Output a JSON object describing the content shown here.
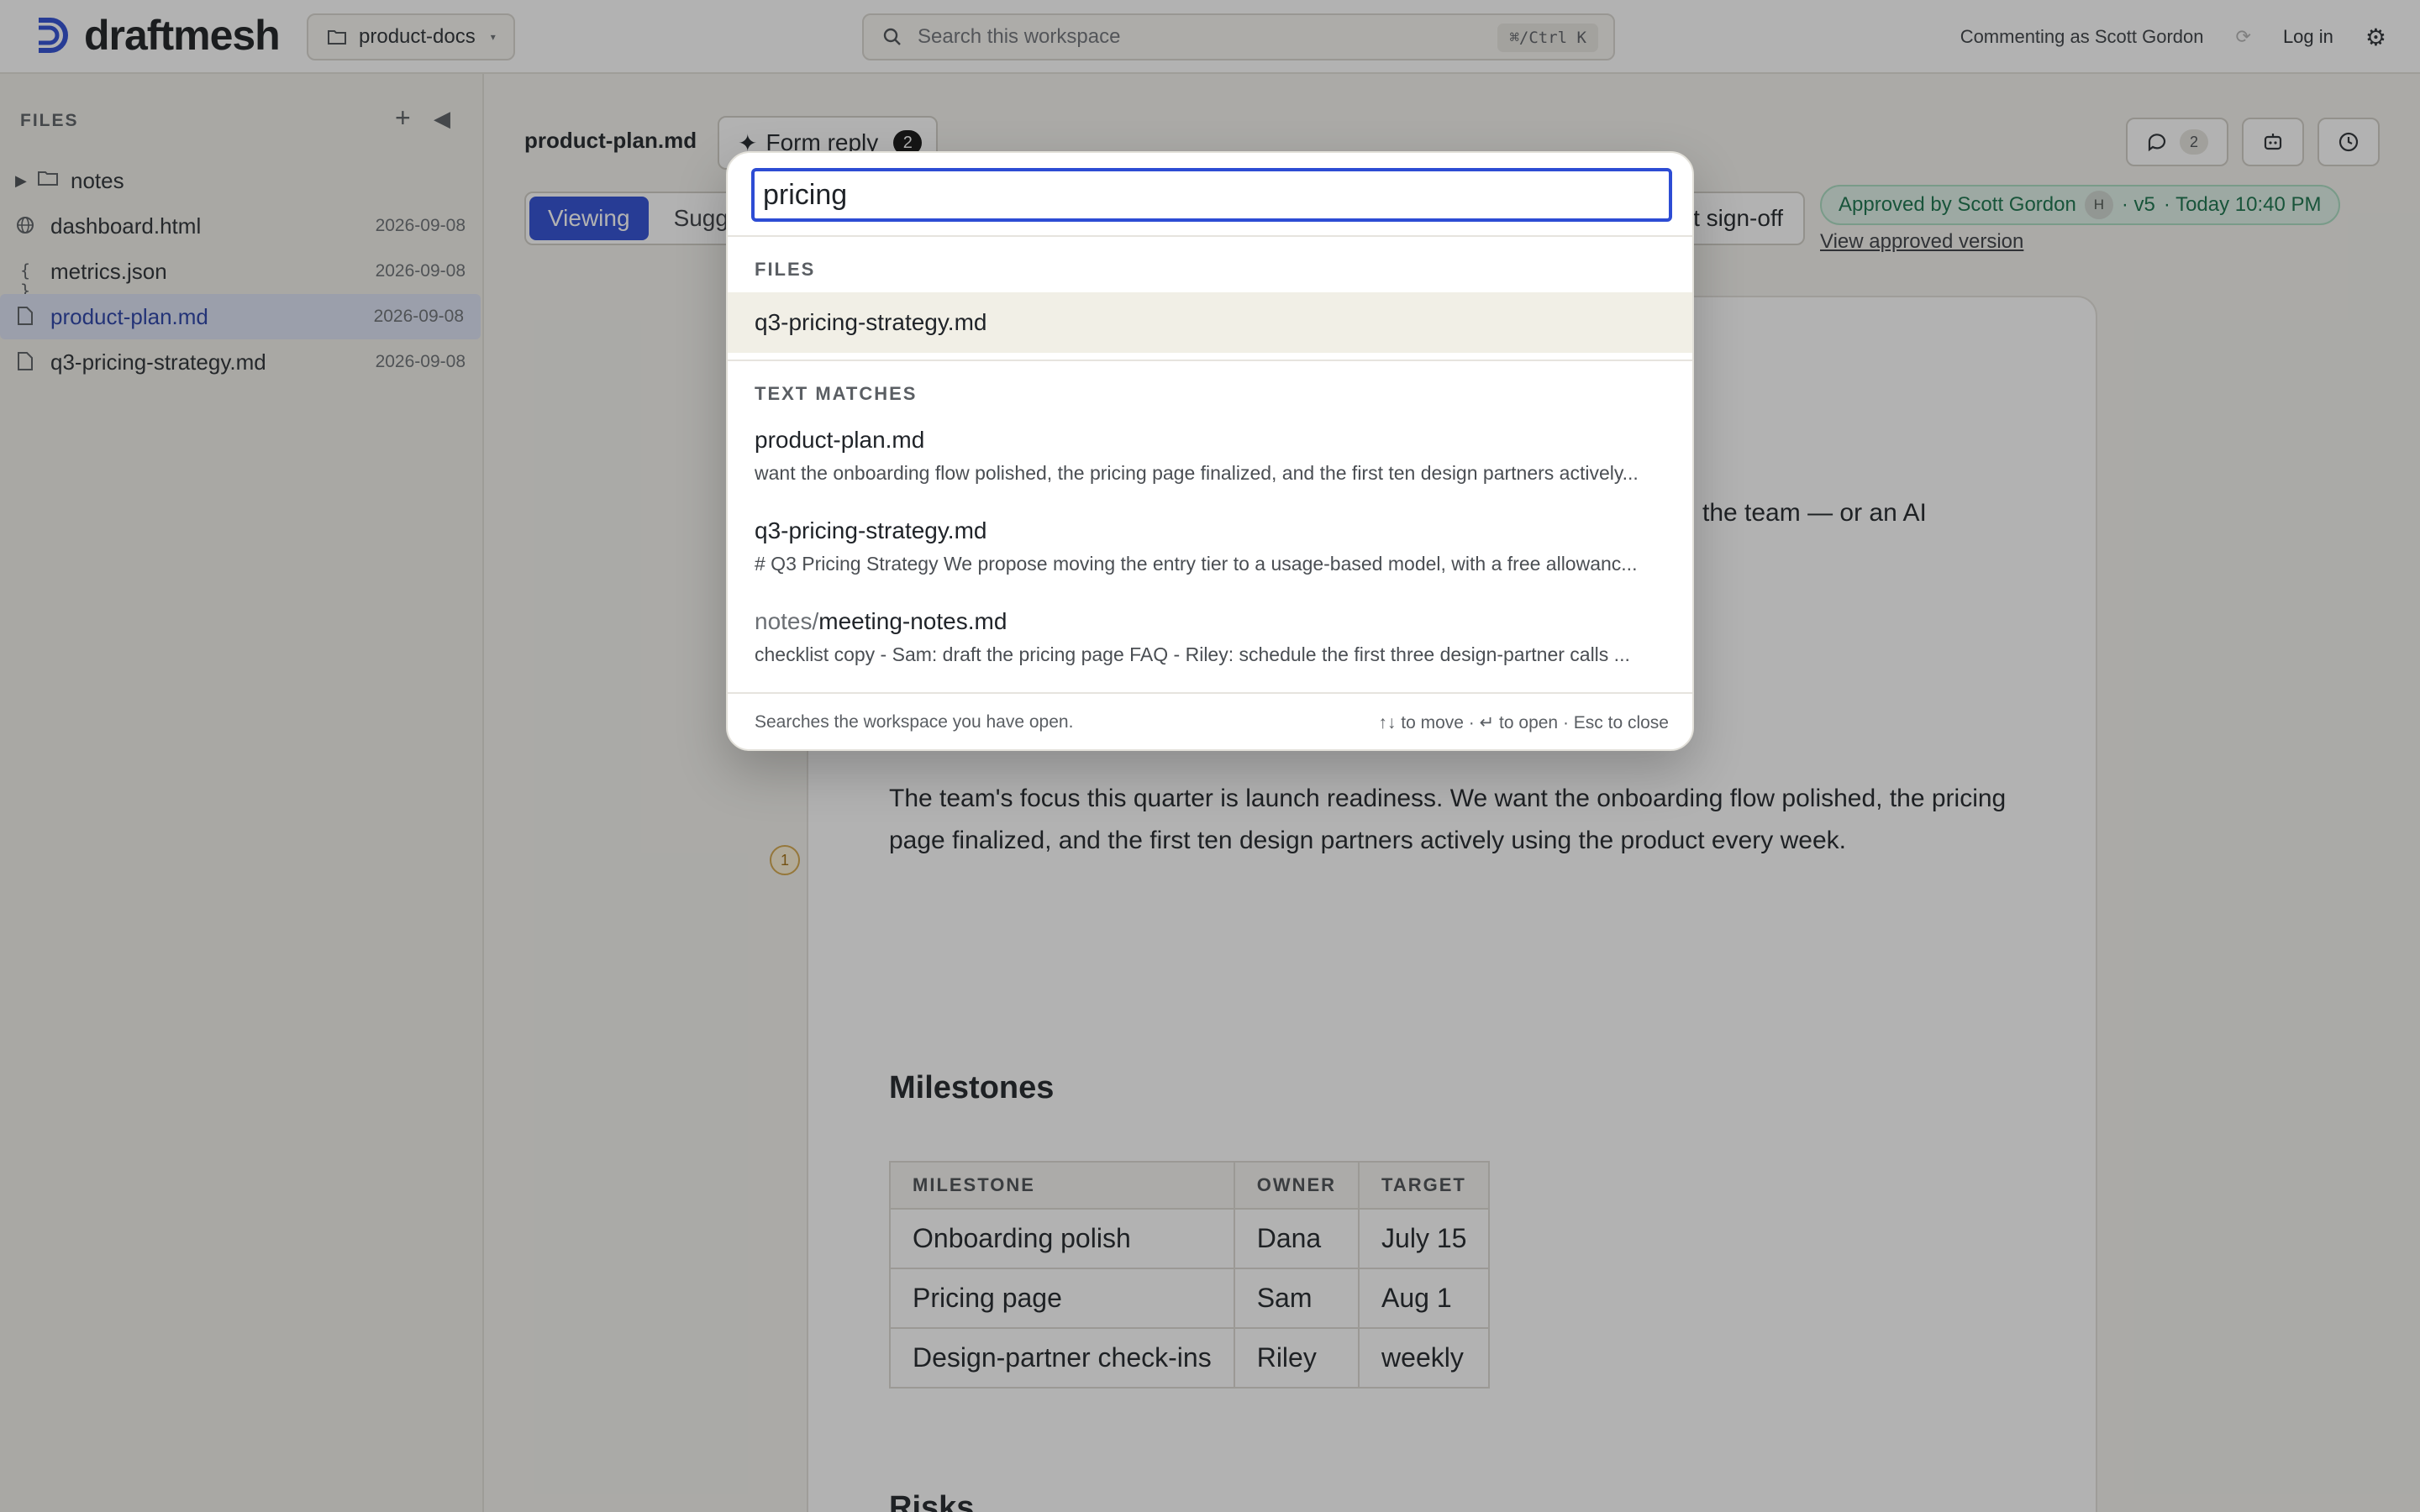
{
  "topbar": {
    "brand": "draftmesh",
    "workspace": "product-docs",
    "search_placeholder": "Search this workspace",
    "search_shortcut": "⌘/Ctrl K",
    "commenting": "Commenting as Scott Gordon",
    "login": "Log in"
  },
  "sidebar": {
    "heading": "FILES",
    "items": [
      {
        "name": "notes",
        "type": "folder",
        "date": ""
      },
      {
        "name": "dashboard.html",
        "type": "html",
        "date": "2026-09-08"
      },
      {
        "name": "metrics.json",
        "type": "json",
        "date": "2026-09-08"
      },
      {
        "name": "product-plan.md",
        "type": "md",
        "date": "2026-09-08",
        "selected": true
      },
      {
        "name": "q3-pricing-strategy.md",
        "type": "md",
        "date": "2026-09-08"
      }
    ]
  },
  "main": {
    "doc_title": "product-plan.md",
    "form_reply": "Form reply",
    "form_reply_count": "2",
    "mode_viewing": "Viewing",
    "mode_suggesting": "Sugg",
    "signoff": "t sign-off",
    "approved_by": "Approved by Scott Gordon",
    "approved_initial": "H",
    "approved_version": "· v5",
    "approved_time": "· Today 10:40 PM",
    "view_approved": "View approved version",
    "comments_count": "2",
    "partial_text": "the team — or an AI",
    "paragraph": "The team's focus this quarter is launch readiness. We want the onboarding flow polished, the pricing page finalized, and the first ten design partners actively using the product every week.",
    "comment_marker": "1",
    "milestones_heading": "Milestones",
    "risks_heading": "Risks",
    "table": {
      "headers": [
        "MILESTONE",
        "OWNER",
        "TARGET"
      ],
      "rows": [
        [
          "Onboarding polish",
          "Dana",
          "July 15"
        ],
        [
          "Pricing page",
          "Sam",
          "Aug 1"
        ],
        [
          "Design-partner check-ins",
          "Riley",
          "weekly"
        ]
      ]
    }
  },
  "palette": {
    "query": "pricing",
    "files_heading": "FILES",
    "file_result": "q3-pricing-strategy.md",
    "text_heading": "TEXT MATCHES",
    "matches": [
      {
        "dir": "",
        "title": "product-plan.md",
        "snippet": "want the onboarding flow polished, the pricing page finalized, and the first ten design partners actively..."
      },
      {
        "dir": "",
        "title": "q3-pricing-strategy.md",
        "snippet": "# Q3 Pricing Strategy We propose moving the entry tier to a usage-based model, with a free allowanc..."
      },
      {
        "dir": "notes/",
        "title": "meeting-notes.md",
        "snippet": "checklist copy - Sam: draft the pricing page FAQ - Riley: schedule the first three design-partner calls ..."
      }
    ],
    "footer_left": "Searches the workspace you have open.",
    "footer_right": "↑↓ to move · ↵ to open · Esc to close"
  },
  "colors": {
    "accent": "#2d4cd4",
    "approved_bg": "#dff2e8",
    "approved_text": "#16714a",
    "selected_row": "#dde2f4"
  }
}
